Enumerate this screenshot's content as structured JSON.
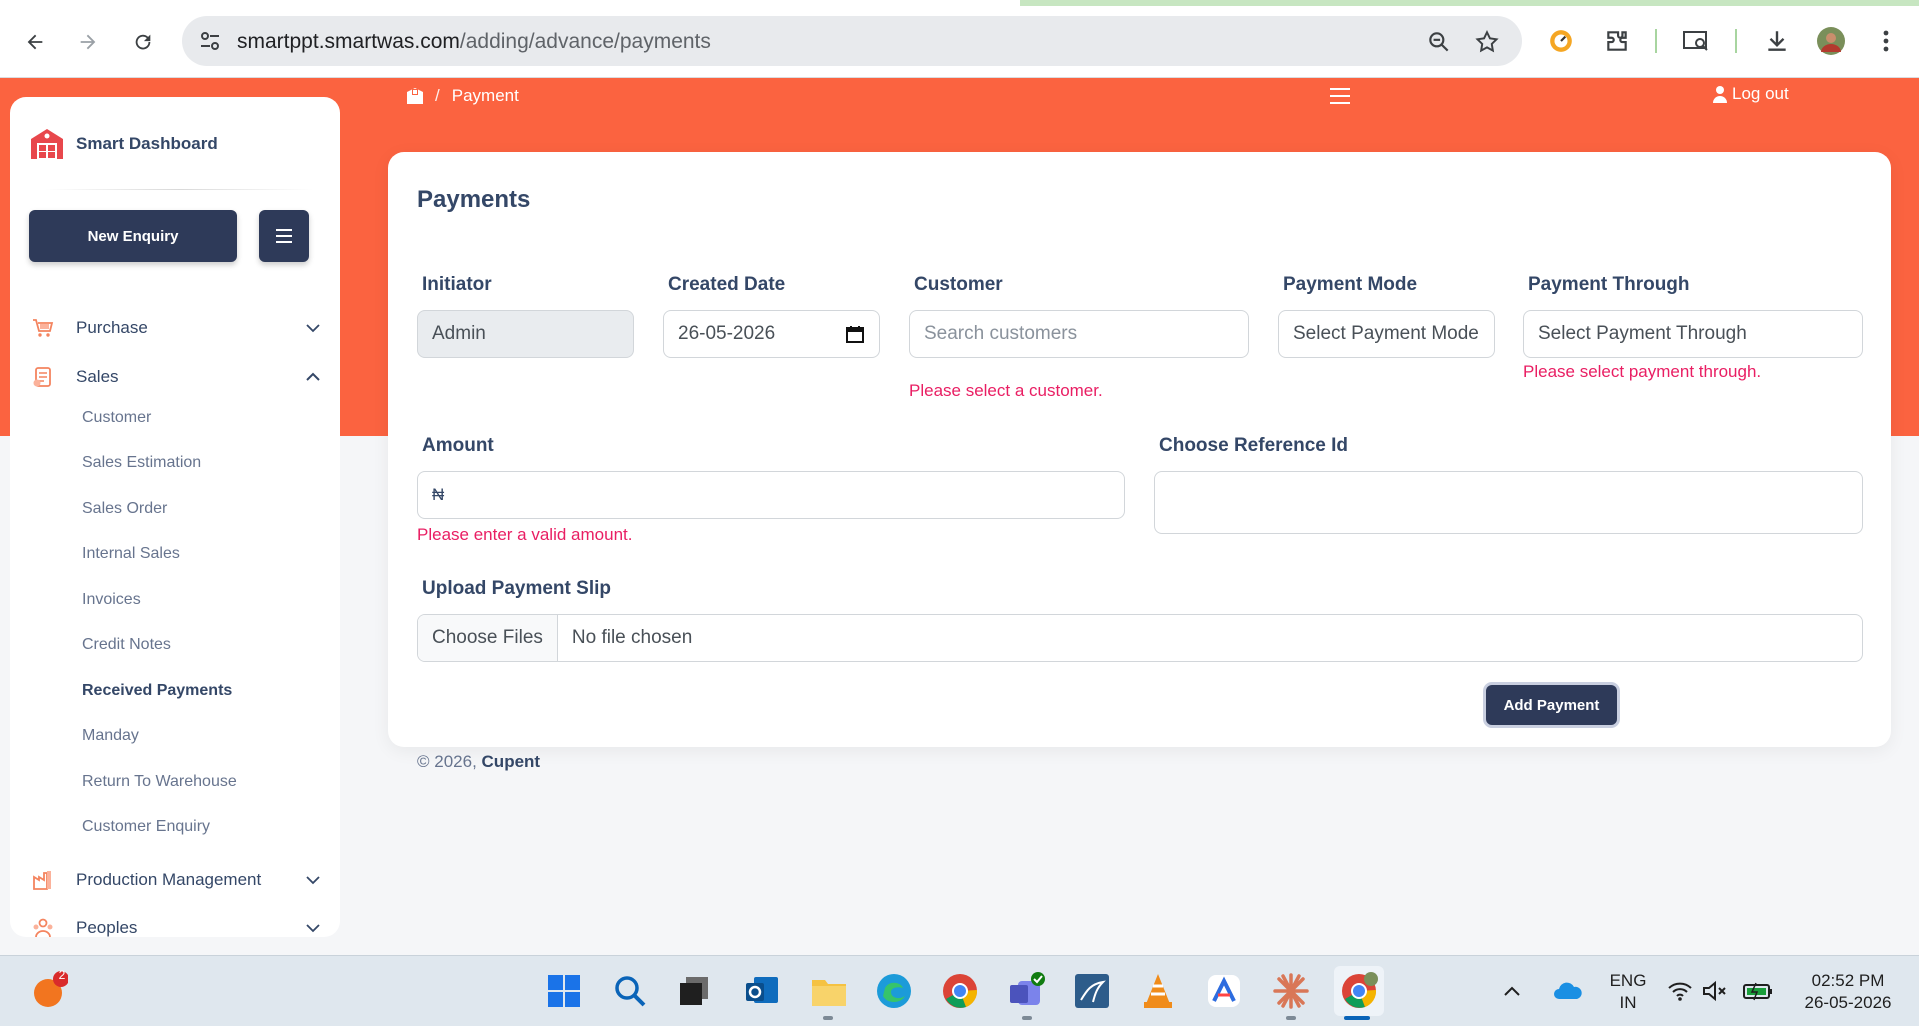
{
  "browser": {
    "url_host": "smartppt.smartwas.com",
    "url_path": "/adding/advance/payments"
  },
  "sidebar": {
    "brand": "Smart Dashboard",
    "new_enquiry": "New Enquiry",
    "items": [
      {
        "label": "Purchase",
        "icon": "cart-icon",
        "expanded": false
      },
      {
        "label": "Sales",
        "icon": "sales-icon",
        "expanded": true
      },
      {
        "label": "Production Management",
        "icon": "factory-icon",
        "expanded": false
      },
      {
        "label": "Peoples",
        "icon": "people-icon",
        "expanded": false
      }
    ],
    "sales_sub": [
      {
        "label": "Customer"
      },
      {
        "label": "Sales Estimation"
      },
      {
        "label": "Sales Order"
      },
      {
        "label": "Internal Sales"
      },
      {
        "label": "Invoices"
      },
      {
        "label": "Credit Notes"
      },
      {
        "label": "Received Payments",
        "active": true
      },
      {
        "label": "Manday"
      },
      {
        "label": "Return To Warehouse"
      },
      {
        "label": "Customer Enquiry"
      }
    ]
  },
  "topbar": {
    "breadcrumb_sep": "/",
    "breadcrumb": "Payment",
    "logout": "Log out"
  },
  "form": {
    "title": "Payments",
    "initiator_label": "Initiator",
    "initiator_value": "Admin",
    "created_date_label": "Created Date",
    "created_date_value": "26-05-2026",
    "customer_label": "Customer",
    "customer_placeholder": "Search customers",
    "customer_error": "Please select a customer.",
    "payment_mode_label": "Payment Mode",
    "payment_mode_value": "Select Payment Mode",
    "payment_through_label": "Payment Through",
    "payment_through_value": "Select Payment Through",
    "payment_through_error": "Please select payment through.",
    "amount_label": "Amount",
    "amount_prefix": "₦",
    "amount_error": "Please enter a valid amount.",
    "reference_label": "Choose Reference Id",
    "upload_label": "Upload Payment Slip",
    "choose_files": "Choose Files",
    "no_file": "No file chosen",
    "submit": "Add Payment"
  },
  "footer": {
    "copyright": "© 2026,",
    "company": "Cupent"
  },
  "taskbar": {
    "notification_badge": "2",
    "lang_1": "ENG",
    "lang_2": "IN",
    "time": "02:52 PM",
    "date": "26-05-2026"
  },
  "colors": {
    "accent": "#fb6340",
    "primary": "#2e3a59",
    "error": "#e91e63"
  }
}
